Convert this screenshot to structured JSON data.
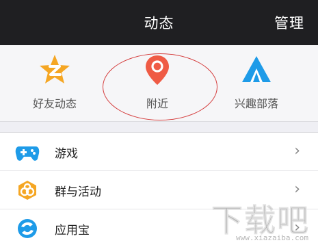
{
  "header": {
    "title": "动态",
    "action_label": "管理"
  },
  "quick_bar": {
    "items": [
      {
        "label": "好友动态",
        "icon": "star-z-icon"
      },
      {
        "label": "附近",
        "icon": "location-pin-icon"
      },
      {
        "label": "兴趣部落",
        "icon": "tent-icon"
      }
    ]
  },
  "list": {
    "items": [
      {
        "label": "游戏",
        "icon": "gamepad-icon"
      },
      {
        "label": "群与活动",
        "icon": "group-activity-icon"
      },
      {
        "label": "应用宝",
        "icon": "app-store-icon"
      }
    ],
    "chevron": "›"
  },
  "watermark": {
    "main": "下载吧",
    "url": "www.xiazaiba.com"
  },
  "colors": {
    "header_bg": "#1f1f22",
    "star": "#f5a623",
    "pin": "#ef5b45",
    "tent": "#1e9be8",
    "highlight": "#d43a3a"
  }
}
